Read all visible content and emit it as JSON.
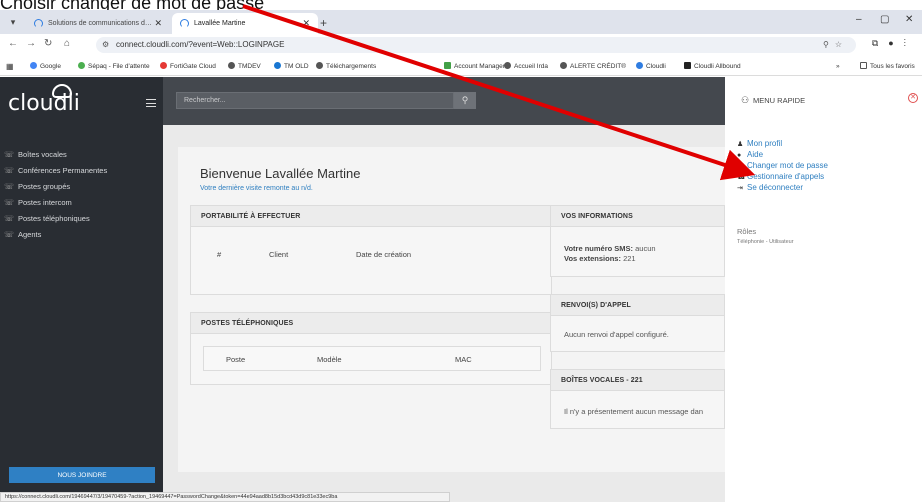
{
  "caption": "Choisir changer de mot de passe",
  "browser": {
    "tabs": [
      {
        "label": "Solutions de communications d…",
        "active": false
      },
      {
        "label": "Lavallée Martine",
        "active": true
      }
    ],
    "url": "connect.cloudli.com/?event=Web::LOGINPAGE",
    "bookmarks": [
      "Google",
      "Sépaq - File d'attente",
      "FortiGate Cloud",
      "TMDEV",
      "TM OLD",
      "Téléchargements",
      "Account Manager",
      "Accueil Irda",
      "ALERTE CRÉDIT®",
      "Cloudli",
      "Cloudli Allbound",
      "Tous les favoris"
    ],
    "status_url": "https://connect.cloudli.com/19469447/3/19470459-?action_19469447=PasswordChange&token=44e94aad8b15d3bcd43d9c81e33ec9ba"
  },
  "app": {
    "logo": "cloudli",
    "search_placeholder": "Rechercher...",
    "sidebar": [
      "Boîtes vocales",
      "Conférences Permanentes",
      "Postes groupés",
      "Postes intercom",
      "Postes téléphoniques",
      "Agents"
    ],
    "join_label": "NOUS JOINDRE",
    "welcome": "Bienvenue Lavallée Martine",
    "last_visit": "Votre dernière visite remonte au n/d.",
    "portabilite": {
      "title": "PORTABILITÉ À EFFECTUER",
      "columns": [
        "#",
        "Client",
        "Date de création"
      ]
    },
    "postes": {
      "title": "POSTES TÉLÉPHONIQUES",
      "columns": [
        "Poste",
        "Modèle",
        "MAC"
      ]
    },
    "infos": {
      "title": "VOS INFORMATIONS",
      "sms_label": "Votre numéro SMS:",
      "sms_value": "aucun",
      "ext_label": "Vos extensions:",
      "ext_value": "221"
    },
    "renvoi": {
      "title": "RENVOI(S) D'APPEL",
      "text": "Aucun renvoi d'appel configuré."
    },
    "boites": {
      "title": "BOÎTES VOCALES - 221",
      "text": "Il n'y a présentement aucun message dan"
    }
  },
  "menu": {
    "title": "MENU RAPIDE",
    "items": [
      "Mon profil",
      "Aide",
      "Changer mot de passe",
      "Gestionnaire d'appels",
      "Se déconnecter"
    ],
    "roles_title": "Rôles",
    "role": "Téléphonie - Utilisateur"
  }
}
